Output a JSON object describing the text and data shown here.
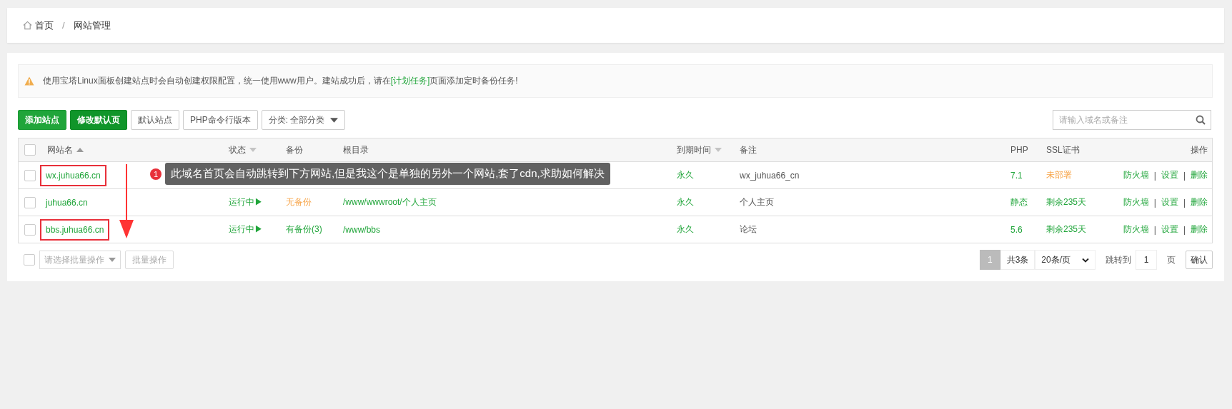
{
  "breadcrumb": {
    "items": [
      {
        "label": "首页"
      },
      {
        "label": "网站管理"
      }
    ],
    "separator": "/"
  },
  "notice": {
    "before": "使用宝塔Linux面板创建站点时会自动创建权限配置，统一使用www用户。建站成功后，请在",
    "link": "[计划任务]",
    "after": "页面添加定时备份任务!"
  },
  "toolbar": {
    "buttons": [
      {
        "label": "添加站点",
        "kind": "primary"
      },
      {
        "label": "修改默认页",
        "kind": "dark"
      },
      {
        "label": "默认站点",
        "kind": "default"
      },
      {
        "label": "PHP命令行版本",
        "kind": "default"
      }
    ],
    "category": "分类: 全部分类",
    "search": {
      "placeholder": "请输入域名或备注"
    }
  },
  "table": {
    "select_all": {
      "checked": false
    },
    "columns": [
      {
        "label": "网站名",
        "sorted": true
      },
      {
        "label": "状态",
        "sorted": false
      },
      {
        "label": "备份"
      },
      {
        "label": "根目录"
      },
      {
        "label": "到期时间",
        "sorted": false
      },
      {
        "label": "备注"
      },
      {
        "label": "PHP"
      },
      {
        "label": "SSL证书"
      },
      {
        "label": "操作"
      }
    ],
    "rows": [
      {
        "checked": false,
        "boxed": true,
        "name": "wx.juhua66.cn",
        "expire": "永久",
        "remark": "wx_juhua66_cn",
        "php": "7.1",
        "ssl": "未部署",
        "ssl_warning": true,
        "actions": [
          {
            "label": "防火墙",
            "kind": "link"
          },
          {
            "label": "|",
            "kind": "separator"
          },
          {
            "label": "设置",
            "kind": "link"
          },
          {
            "label": "|",
            "kind": "separator"
          },
          {
            "label": "删除",
            "kind": "link"
          }
        ]
      },
      {
        "checked": false,
        "boxed": false,
        "name": "juhua66.cn",
        "status": "运行中▶",
        "backup": "无备份",
        "backup_warning": true,
        "root": "/www/wwwroot/个人主页",
        "expire": "永久",
        "remark": "个人主页",
        "php": "静态",
        "ssl": "剩余235天",
        "ssl_warning": false,
        "actions": [
          {
            "label": "防火墙",
            "kind": "link"
          },
          {
            "label": "|",
            "kind": "separator"
          },
          {
            "label": "设置",
            "kind": "link"
          },
          {
            "label": "|",
            "kind": "separator"
          },
          {
            "label": "删除",
            "kind": "link"
          }
        ]
      },
      {
        "checked": false,
        "boxed": true,
        "name": "bbs.juhua66.cn",
        "status": "运行中▶",
        "backup": "有备份(3)",
        "backup_warning": false,
        "root": "/www/bbs",
        "expire": "永久",
        "remark": "论坛",
        "php": "5.6",
        "ssl": "剩余235天",
        "ssl_warning": false,
        "actions": [
          {
            "label": "防火墙",
            "kind": "link"
          },
          {
            "label": "|",
            "kind": "separator"
          },
          {
            "label": "设置",
            "kind": "link"
          },
          {
            "label": "|",
            "kind": "separator"
          },
          {
            "label": "删除",
            "kind": "link"
          }
        ]
      }
    ]
  },
  "footer": {
    "select_all": {
      "checked": false
    },
    "batch_placeholder": "请选择批量操作",
    "batch_button": "批量操作",
    "pagination": {
      "pages": [
        {
          "label": "1",
          "selected": true
        }
      ],
      "total": "共3条",
      "per_page": "20条/页",
      "goto_label": "跳转到",
      "goto_value": "1",
      "goto_unit": "页",
      "confirm": "确认"
    }
  },
  "annotation": {
    "badge": "1",
    "text": "此域名首页会自动跳转到下方网站,但是我这个是单独的另外一个网站,套了cdn,求助如何解决"
  }
}
